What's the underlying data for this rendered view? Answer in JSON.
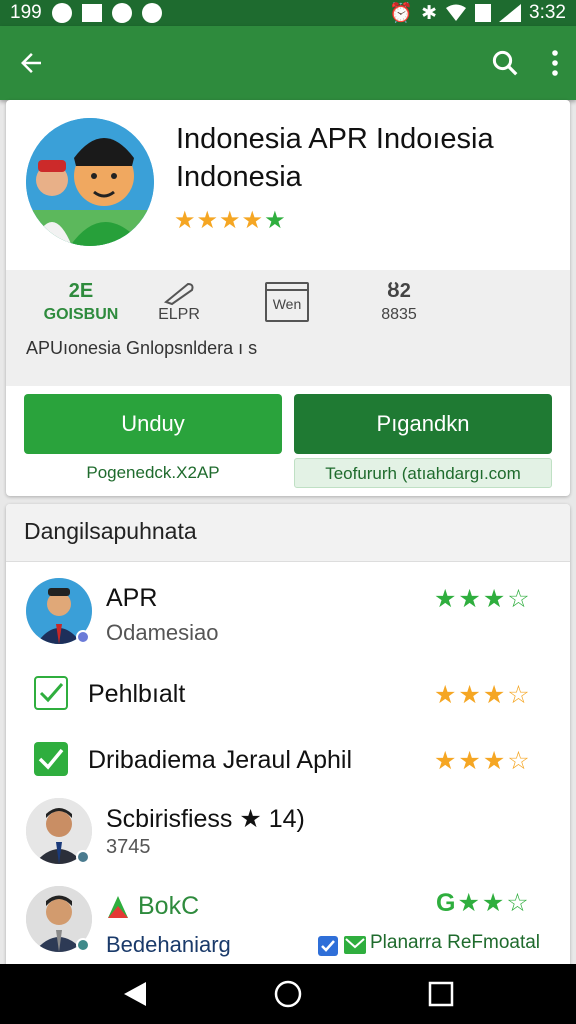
{
  "status_bar": {
    "time_left": "199",
    "time_right": "3:32"
  },
  "toolbar": {
    "back_icon": "arrow-left-icon",
    "search_icon": "search-icon",
    "more_icon": "more-vert-icon"
  },
  "app": {
    "title": "Indonesia APR Indoıesia Indonesia",
    "rating_stars": 5
  },
  "info": {
    "item1_top": "2E",
    "item1_bottom": "GOISBUN",
    "item2_bottom": "ELPR",
    "item3_bottom": "Wen",
    "item4_top": "ȣ2",
    "item4_bottom": "8835",
    "subline": "APUıonesia   Gnlopsnldera ı s"
  },
  "buttons": {
    "download": "Unduy",
    "pg": "Pıgandkn",
    "sub_left": "Pogenedck.X2AP",
    "sub_right": "Teofururh (atıahdargı.com"
  },
  "list": {
    "header": "Dangilsapuhnata",
    "rows": [
      {
        "title": "APR",
        "sub": "Odamesiao",
        "stars": "★★★☆"
      },
      {
        "title": "Pehlbıalt",
        "stars": "★★★☆"
      },
      {
        "title": "Dribadiema Jeraul Aphil",
        "stars": "★★★☆"
      },
      {
        "title": "Scbirisfiess ★ 14)",
        "sub": "3745"
      },
      {
        "title": "BokC",
        "sub": "Bedehaniarg",
        "stars": "★★☆",
        "right_label": "Planarra ReFmoatal",
        "right_prefix": "G"
      }
    ]
  },
  "colors": {
    "brand_green": "#2e8b3d",
    "status_green": "#1e6b2f",
    "star_gold": "#f5a623",
    "star_green": "#2fae3e"
  }
}
